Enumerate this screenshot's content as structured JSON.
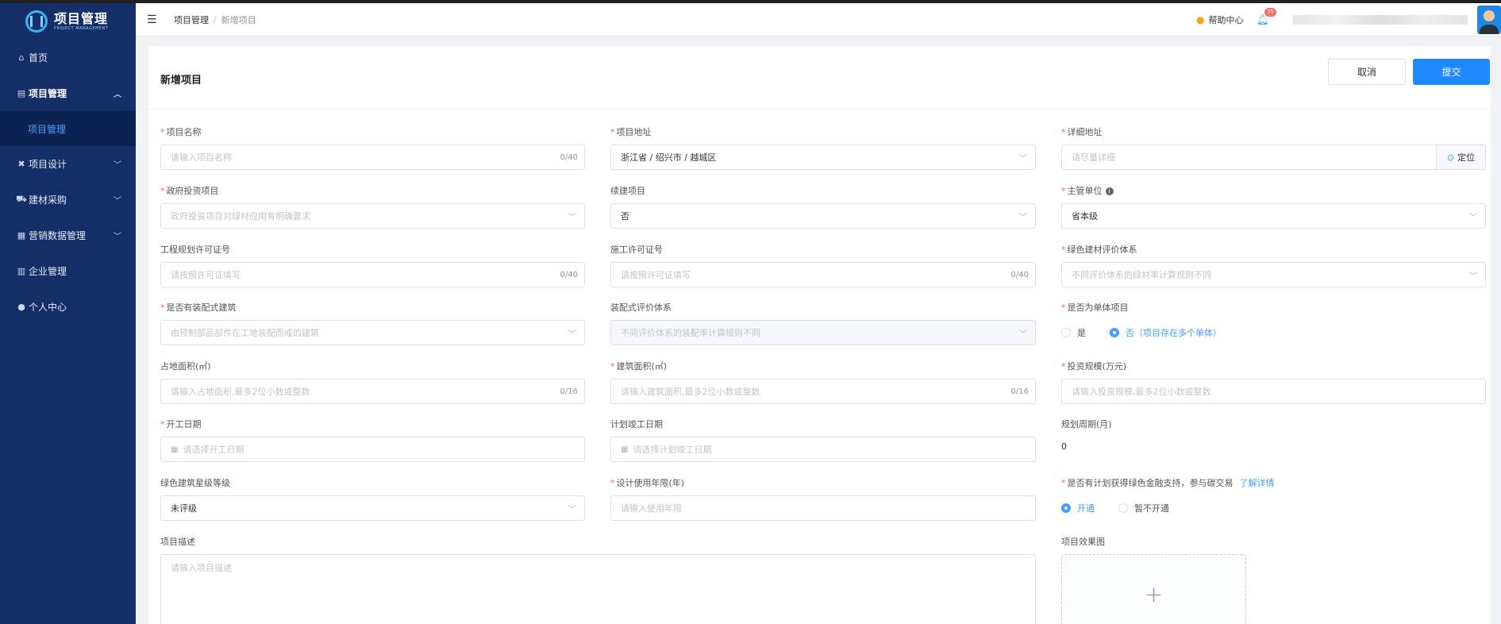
{
  "app": {
    "logo_title": "项目管理",
    "logo_sub": "PROJECT MANAGEMENT"
  },
  "sidebar": {
    "items": [
      {
        "label": "首页",
        "icon": "home-icon"
      },
      {
        "label": "项目管理",
        "icon": "book-icon",
        "expanded": true
      },
      {
        "label": "项目设计",
        "icon": "tools-icon"
      },
      {
        "label": "建材采购",
        "icon": "truck-icon"
      },
      {
        "label": "营销数据管理",
        "icon": "chart-icon"
      },
      {
        "label": "企业管理",
        "icon": "building-icon"
      },
      {
        "label": "个人中心",
        "icon": "user-icon"
      }
    ],
    "submenu_active": "项目管理"
  },
  "header": {
    "breadcrumb": [
      "项目管理",
      "新增项目"
    ],
    "help_label": "帮助中心",
    "notification_count": "35"
  },
  "page": {
    "title": "新增项目",
    "cancel_label": "取消",
    "submit_label": "提交"
  },
  "form": {
    "project_name": {
      "label": "项目名称",
      "placeholder": "请输入项目名称",
      "counter": "0/40"
    },
    "project_address": {
      "label": "项目地址",
      "value": "浙江省 / 绍兴市 / 越城区"
    },
    "detail_address": {
      "label": "详细地址",
      "placeholder": "请尽量详细",
      "locate_label": "定位"
    },
    "gov_investment": {
      "label": "政府投资项目",
      "placeholder": "政府投资项目对绿材应用有明确要求"
    },
    "continued_project": {
      "label": "续建项目",
      "value": "否"
    },
    "authority": {
      "label": "主管单位",
      "value": "省本级"
    },
    "planning_permit": {
      "label": "工程规划许可证号",
      "placeholder": "请按照许可证填写",
      "counter": "0/40"
    },
    "construction_permit": {
      "label": "施工许可证号",
      "placeholder": "请按照许可证填写",
      "counter": "0/40"
    },
    "green_material_system": {
      "label": "绿色建材评价体系",
      "placeholder": "不同评价体系的绿材率计算规则不同"
    },
    "prefab_building": {
      "label": "是否有装配式建筑",
      "placeholder": "由预制部品部件在工地装配而成的建筑"
    },
    "prefab_system": {
      "label": "装配式评价体系",
      "placeholder": "不同评价体系的装配率计算规则不同"
    },
    "single_project": {
      "label": "是否为单体项目",
      "option_yes": "是",
      "option_no": "否（项目存在多个单体）",
      "selected": "no"
    },
    "land_area": {
      "label": "占地面积(㎡)",
      "placeholder": "请输入占地面积,最多2位小数或整数",
      "counter": "0/16"
    },
    "building_area": {
      "label": "建筑面积(㎡)",
      "placeholder": "请输入建筑面积,最多2位小数或整数",
      "counter": "0/16"
    },
    "investment_scale": {
      "label": "投资规模(万元)",
      "placeholder": "请输入投资规模,最多2位小数或整数"
    },
    "start_date": {
      "label": "开工日期",
      "placeholder": "请选择开工日期"
    },
    "planned_completion": {
      "label": "计划竣工日期",
      "placeholder": "请选择计划竣工日期"
    },
    "planning_period": {
      "label": "规划周期(月)",
      "value": "0"
    },
    "green_star_level": {
      "label": "绿色建筑星级等级",
      "value": "未评级"
    },
    "design_life": {
      "label": "设计使用年限(年)",
      "placeholder": "请输入使用年限"
    },
    "green_finance": {
      "label": "是否有计划获得绿色金融支持，参与碳交易",
      "link": "了解详情",
      "option_on": "开通",
      "option_off": "暂不开通",
      "selected": "on"
    },
    "description": {
      "label": "项目描述",
      "placeholder": "请输入项目描述"
    },
    "effect_image": {
      "label": "项目效果图"
    }
  }
}
